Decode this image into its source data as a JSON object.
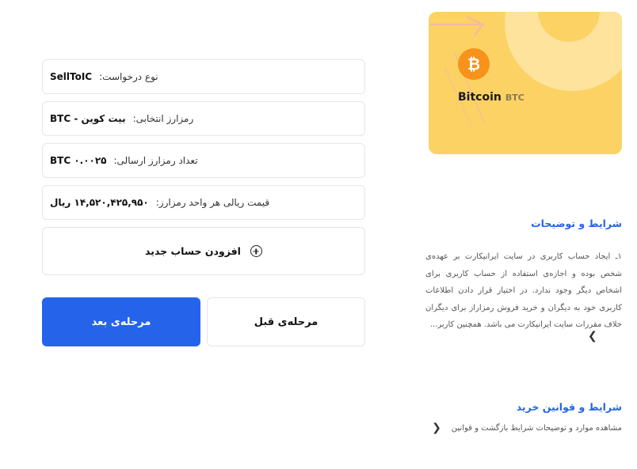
{
  "summary": {
    "request_type_label": "نوع درخواست:",
    "request_type_value": "SellToIC",
    "selected_crypto_label": "رمزارز انتخابی:",
    "selected_crypto_value": "بیت کوین - BTC",
    "amount_label": "تعداد رمزارز ارسالی:",
    "amount_value": "۰.۰۰۲۵ BTC",
    "unit_price_label": "قیمت ریالی هر واحد رمزارز:",
    "unit_price_value": "۱۴,۵۲۰,۴۲۵,۹۵۰ ریال"
  },
  "add_account": {
    "label": "افزودن حساب جدید",
    "icon": "plus-circle-icon"
  },
  "buttons": {
    "next": "مرحله‌ی بعد",
    "prev": "مرحله‌ی قبل"
  },
  "coin": {
    "name": "Bitcoin",
    "symbol": "BTC",
    "glyph": "₿",
    "color": "#f7931a",
    "card_color": "#fcd265"
  },
  "terms": {
    "title": "شرایط و توضیحات",
    "body": "۱ـ ایجاد حساب کاربری در سایت ایرانیکارت بر عهده‌ی شخص بوده و اجازه‌ی استفاده از حساب کاربری برای اشخاص دیگر وجود ندارد. در اختیار قرار دادن اطلاعات کاربری خود به دیگران و خرید فروش رمزاراز برای دیگران خلاف مقررات سایت ایرانیکارت می باشد. همچنین کاربر...",
    "more_icon": "chevron-left-icon"
  },
  "rules": {
    "title": "شرایط و قوانین خرید",
    "link_text": "مشاهده موارد و توضیحات شرایط بازگشت و قوانین",
    "link_icon": "chevron-left-icon"
  },
  "colors": {
    "accent": "#2563eb",
    "border": "#e6e6e6"
  }
}
